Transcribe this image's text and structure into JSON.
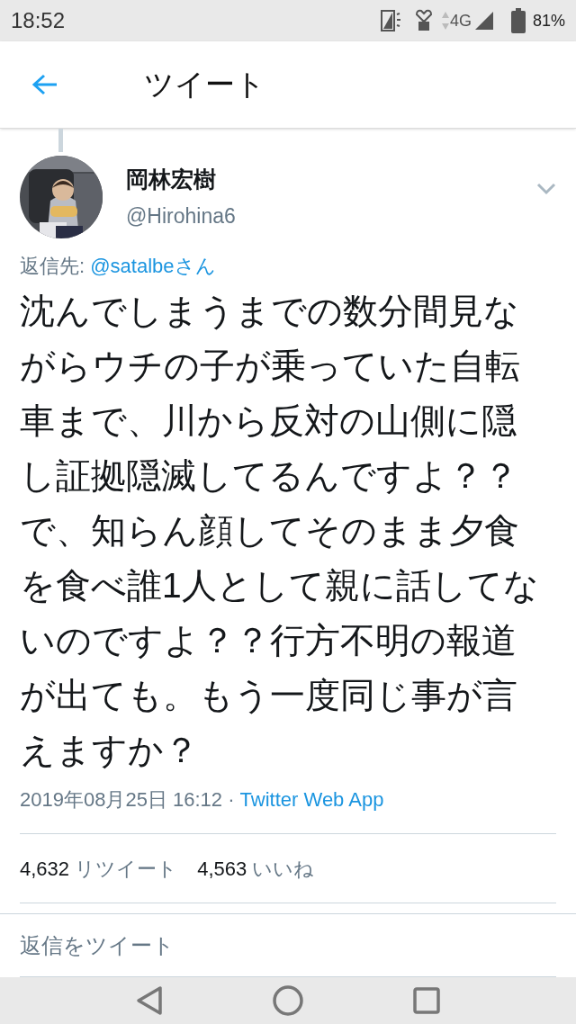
{
  "status_bar": {
    "time": "18:52",
    "network": "4G",
    "battery": "81%"
  },
  "app_bar": {
    "title": "ツイート"
  },
  "tweet": {
    "author_name": "岡林宏樹",
    "handle": "@Hirohina6",
    "reply_label": "返信先:",
    "reply_to": "@satalbeさん",
    "text": "沈んでしまうまでの数分間見ながらウチの子が乗っていた自転車まで、川から反対の山側に隠し証拠隠滅してるんですよ？？で、知らん顔してそのまま夕食を食べ誰1人として親に話してないのですよ？？行方不明の報道が出ても。もう一度同じ事が言えますか？",
    "timestamp": "2019年08月25日 16:12",
    "separator": "·",
    "source": "Twitter Web App",
    "stats": [
      {
        "count": "4,632",
        "label": "リツイート"
      },
      {
        "count": "4,563",
        "label": "いいね"
      }
    ]
  },
  "reply_field": {
    "placeholder": "返信をツイート"
  }
}
